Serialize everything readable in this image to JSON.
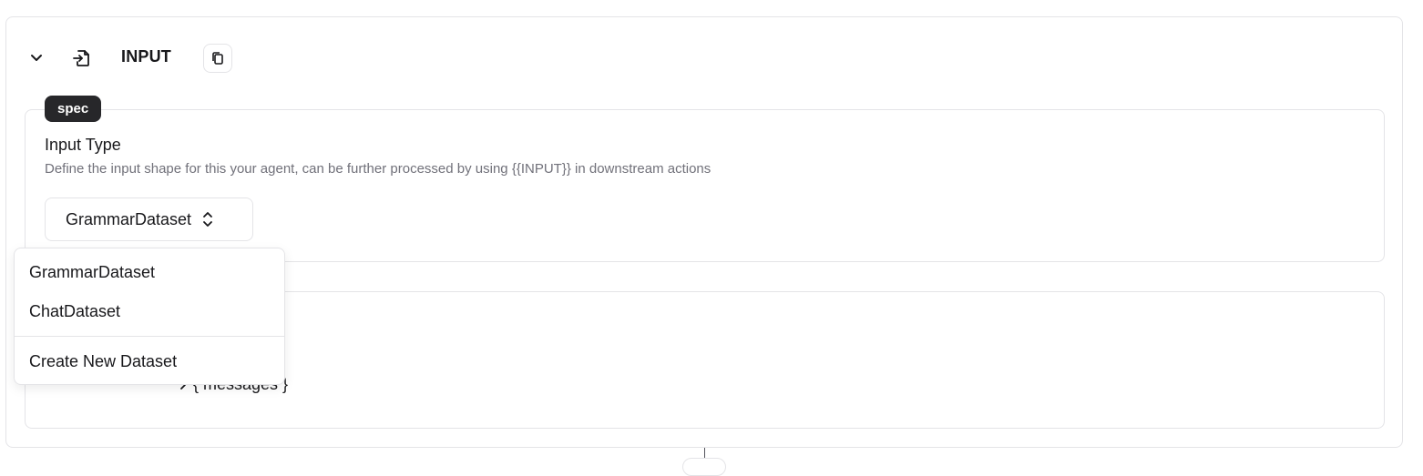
{
  "node": {
    "title": "INPUT",
    "icons": {
      "collapse": "chevron-down-icon",
      "input": "file-input-icon",
      "copy": "copy-icon"
    }
  },
  "spec": {
    "badge": "spec",
    "label": "Input Type",
    "description": "Define the input shape for this your agent, can be further processed by using {{INPUT}} in downstream actions",
    "selected": "GrammarDataset"
  },
  "dropdown": {
    "options": [
      "GrammarDataset",
      "ChatDataset"
    ],
    "create_label": "Create New Dataset"
  },
  "schema": {
    "field_label": "{ messages }"
  },
  "colors": {
    "border": "#e4e4e7",
    "badge_bg": "#27272a",
    "text": "#18181b",
    "muted": "#71717a"
  }
}
